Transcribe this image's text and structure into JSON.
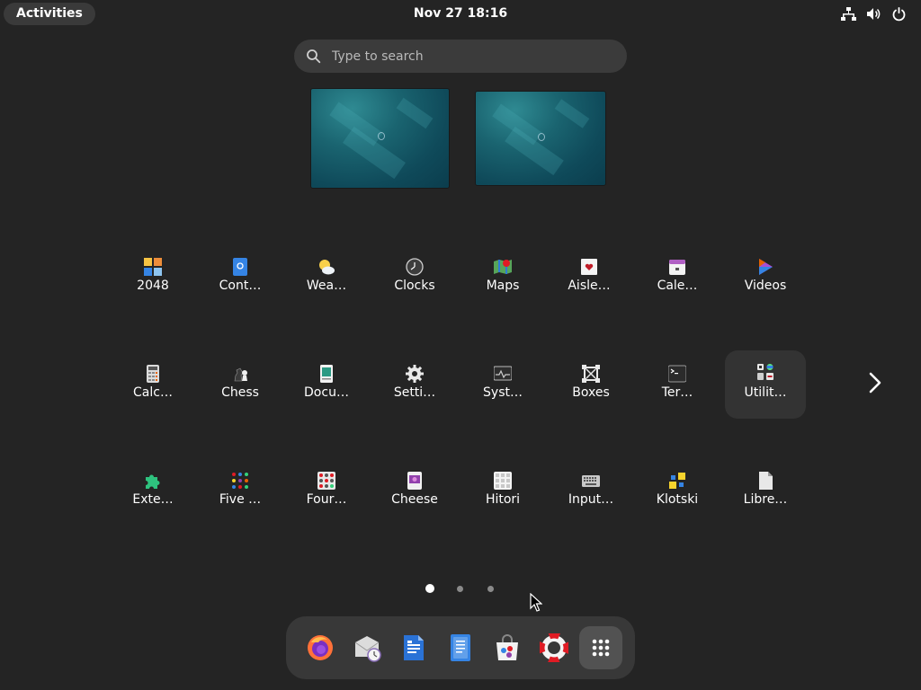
{
  "topbar": {
    "activities_label": "Activities",
    "clock": "Nov 27  18:16",
    "tray_icons": [
      "network-wired-icon",
      "volume-icon",
      "power-icon"
    ]
  },
  "search": {
    "placeholder": "Type to search"
  },
  "apps": [
    {
      "label": "2048",
      "icon": "2048-icon"
    },
    {
      "label": "Cont…",
      "icon": "contacts-icon"
    },
    {
      "label": "Wea…",
      "icon": "weather-icon"
    },
    {
      "label": "Clocks",
      "icon": "clocks-icon"
    },
    {
      "label": "Maps",
      "icon": "maps-icon"
    },
    {
      "label": "Aisle…",
      "icon": "aisleriot-cards-icon"
    },
    {
      "label": "Cale…",
      "icon": "calendar-icon"
    },
    {
      "label": "Videos",
      "icon": "videos-icon"
    },
    {
      "label": "Calc…",
      "icon": "calculator-icon"
    },
    {
      "label": "Chess",
      "icon": "chess-icon"
    },
    {
      "label": "Docu…",
      "icon": "document-viewer-icon"
    },
    {
      "label": "Setti…",
      "icon": "settings-gear-icon"
    },
    {
      "label": "Syst…",
      "icon": "system-monitor-icon"
    },
    {
      "label": "Boxes",
      "icon": "boxes-icon"
    },
    {
      "label": "Ter…",
      "icon": "terminal-icon"
    },
    {
      "label": "Utilit…",
      "icon": "utilities-folder-icon"
    },
    {
      "label": "Exte…",
      "icon": "extensions-puzzle-icon"
    },
    {
      "label": "Five …",
      "icon": "five-or-more-icon"
    },
    {
      "label": "Four…",
      "icon": "four-in-a-row-icon"
    },
    {
      "label": "Cheese",
      "icon": "cheese-icon"
    },
    {
      "label": "Hitori",
      "icon": "hitori-icon"
    },
    {
      "label": "Input…",
      "icon": "input-method-keyboard-icon"
    },
    {
      "label": "Klotski",
      "icon": "klotski-icon"
    },
    {
      "label": "Libre…",
      "icon": "libreoffice-icon"
    }
  ],
  "pagination": {
    "pages": 3,
    "current": 1
  },
  "dock": [
    {
      "name": "firefox",
      "icon": "firefox-icon"
    },
    {
      "name": "evolution",
      "icon": "mail-clock-icon"
    },
    {
      "name": "libreoffice-writer",
      "icon": "writer-document-icon"
    },
    {
      "name": "text-editor",
      "icon": "text-editor-icon"
    },
    {
      "name": "software",
      "icon": "software-bag-icon"
    },
    {
      "name": "help",
      "icon": "help-lifebuoy-icon"
    },
    {
      "name": "show-apps",
      "icon": "app-grid-icon"
    }
  ],
  "colors": {
    "background": "#242424",
    "panel": "#383838",
    "accent_blue": "#3584e4",
    "text": "#ffffff"
  }
}
